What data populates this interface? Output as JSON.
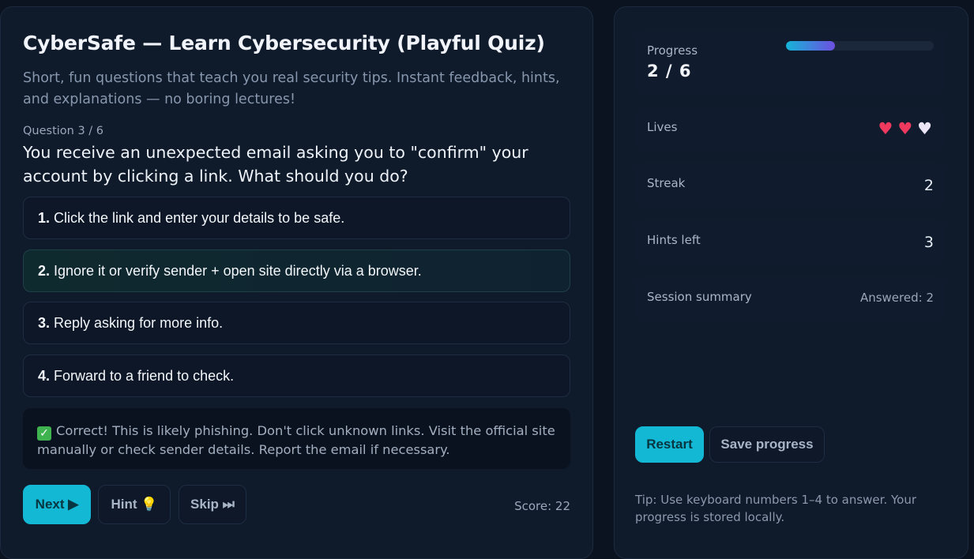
{
  "app": {
    "title": "CyberSafe — Learn Cybersecurity (Playful Quiz)",
    "subtitle": "Short, fun questions that teach you real security tips. Instant feedback, hints, and explanations — no boring lectures!"
  },
  "question": {
    "counter": "Question 3 / 6",
    "text": "You receive an unexpected email asking you to \"confirm\" your account by clicking a link. What should you do?",
    "options": [
      {
        "num": "1.",
        "text": "Click the link and enter your details to be safe."
      },
      {
        "num": "2.",
        "text": "Ignore it or verify sender + open site directly via a browser."
      },
      {
        "num": "3.",
        "text": "Reply asking for more info."
      },
      {
        "num": "4.",
        "text": "Forward to a friend to check."
      }
    ],
    "selected_index": 2
  },
  "feedback": {
    "icon": "check-mark-icon",
    "text": "Correct! This is likely phishing. Don't click unknown links. Visit the official site manually or check sender details. Report the email if necessary."
  },
  "controls": {
    "next_label": "Next ▶",
    "hint_label": "Hint 💡",
    "skip_label": "Skip ⏭",
    "score": "Score: 22"
  },
  "sidebar": {
    "progress": {
      "label": "Progress",
      "value": "2 / 6",
      "fraction": 0.3333
    },
    "lives": {
      "label": "Lives",
      "total": 3,
      "remaining": 2
    },
    "streak": {
      "label": "Streak",
      "value": "2"
    },
    "hints": {
      "label": "Hints left",
      "value": "3"
    },
    "summary": {
      "label": "Session summary",
      "value": "Answered: 2"
    },
    "restart_label": "Restart",
    "save_label": "Save progress",
    "tip": "Tip: Use keyboard numbers 1–4 to answer. Your progress is stored locally."
  },
  "colors": {
    "accent": "#12b8d4",
    "background": "#0b1220",
    "panel": "#0f1a2b",
    "heart": "#f0395f"
  }
}
